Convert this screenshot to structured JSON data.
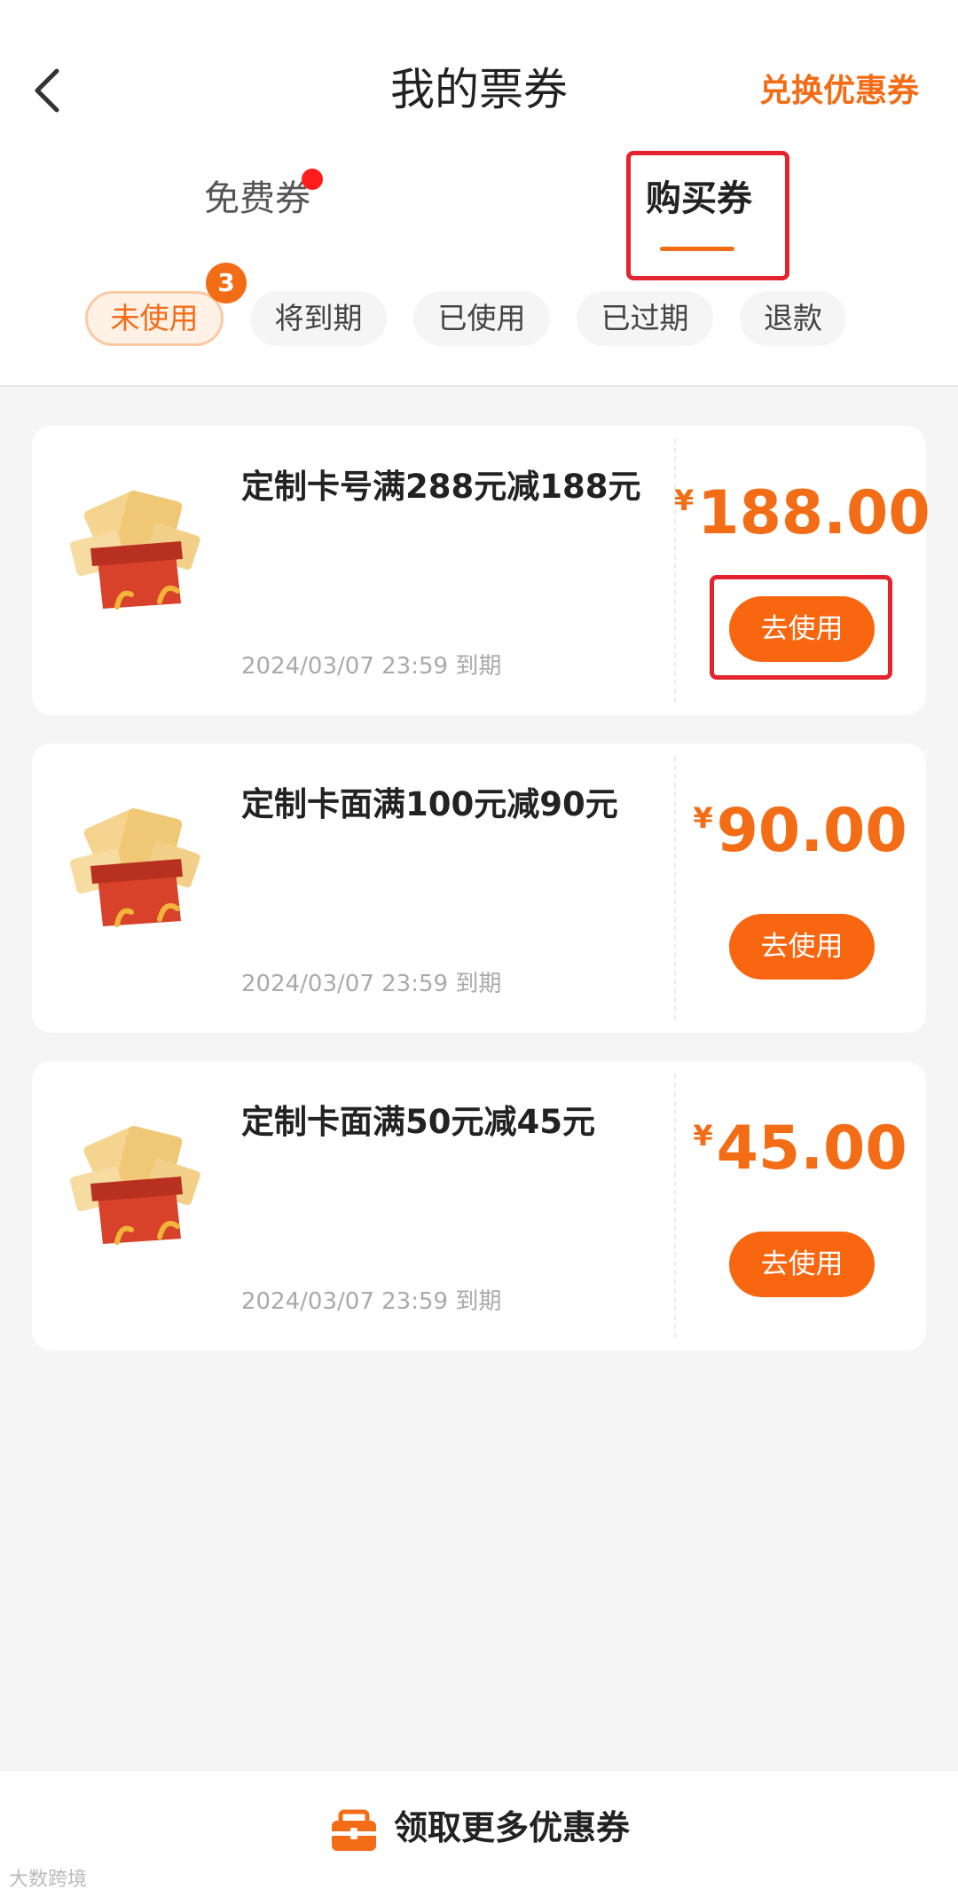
{
  "header": {
    "title": "我的票券",
    "redeem_label": "兑换优惠券"
  },
  "tabs": [
    {
      "label": "免费券",
      "has_dot": true
    },
    {
      "label": "购买券",
      "active": true
    }
  ],
  "filters": [
    {
      "label": "未使用",
      "active": true,
      "badge": "3"
    },
    {
      "label": "将到期"
    },
    {
      "label": "已使用"
    },
    {
      "label": "已过期"
    },
    {
      "label": "退款"
    }
  ],
  "coupons": [
    {
      "name": "定制卡号满288元减188元",
      "amount": "188.00",
      "currency": "¥",
      "expiry": "2024/03/07 23:59 到期",
      "button": "去使用"
    },
    {
      "name": "定制卡面满100元减90元",
      "amount": "90.00",
      "currency": "¥",
      "expiry": "2024/03/07 23:59 到期",
      "button": "去使用"
    },
    {
      "name": "定制卡面满50元减45元",
      "amount": "45.00",
      "currency": "¥",
      "expiry": "2024/03/07 23:59 到期",
      "button": "去使用"
    }
  ],
  "bottom": {
    "action_label": "领取更多优惠券"
  },
  "watermark": "大数跨境",
  "colors": {
    "accent": "#f36c16",
    "annotation": "#e3232d",
    "badge_dot": "#ff1c1c"
  },
  "icons": [
    "back-arrow-icon",
    "gift-box-icon",
    "coupon-bag-icon"
  ]
}
